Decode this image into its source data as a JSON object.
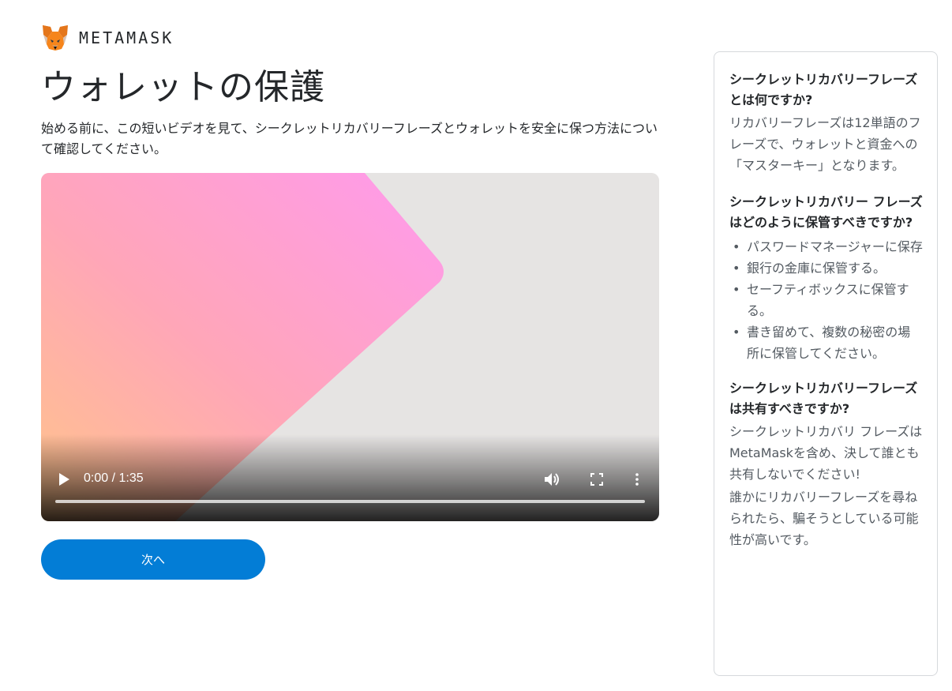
{
  "brand": {
    "wordmark": "METAMASK",
    "logo_icon": "metamask-fox-icon"
  },
  "page": {
    "title": "ウォレットの保護",
    "intro": "始める前に、この短いビデオを見て、シークレットリカバリーフレーズとウォレットを安全に保つ方法について確認してください。"
  },
  "video": {
    "time": "0:00 / 1:35",
    "progress": 0,
    "icons": [
      "play-icon",
      "volume-icon",
      "fullscreen-icon",
      "more-options-icon"
    ]
  },
  "next_button": {
    "label": "次へ"
  },
  "sidebar": {
    "q1": {
      "title": "シークレットリカバリーフレーズとは何ですか?",
      "body": "リカバリーフレーズは12単語のフレーズで、ウォレットと資金への「マスターキー」となります。"
    },
    "q2": {
      "title": "シークレットリカバリー フレーズはどのように保管すべきですか?",
      "items": [
        "パスワードマネージャーに保存",
        "銀行の金庫に保管する。",
        "セーフティボックスに保管する。",
        "書き留めて、複数の秘密の場所に保管してください。"
      ]
    },
    "q3": {
      "title": "シークレットリカバリーフレーズは共有すべきですか?",
      "body": "シークレットリカバリ フレーズはMetaMaskを含め、決して誰とも共有しないでください!"
    },
    "warning": "誰かにリカバリーフレーズを尋ねられたら、騙そうとしている可能性が高いです。"
  },
  "colors": {
    "accent": "#037dd6",
    "text": "#24272a",
    "muted": "#535a61",
    "border": "#d6d9dc"
  }
}
